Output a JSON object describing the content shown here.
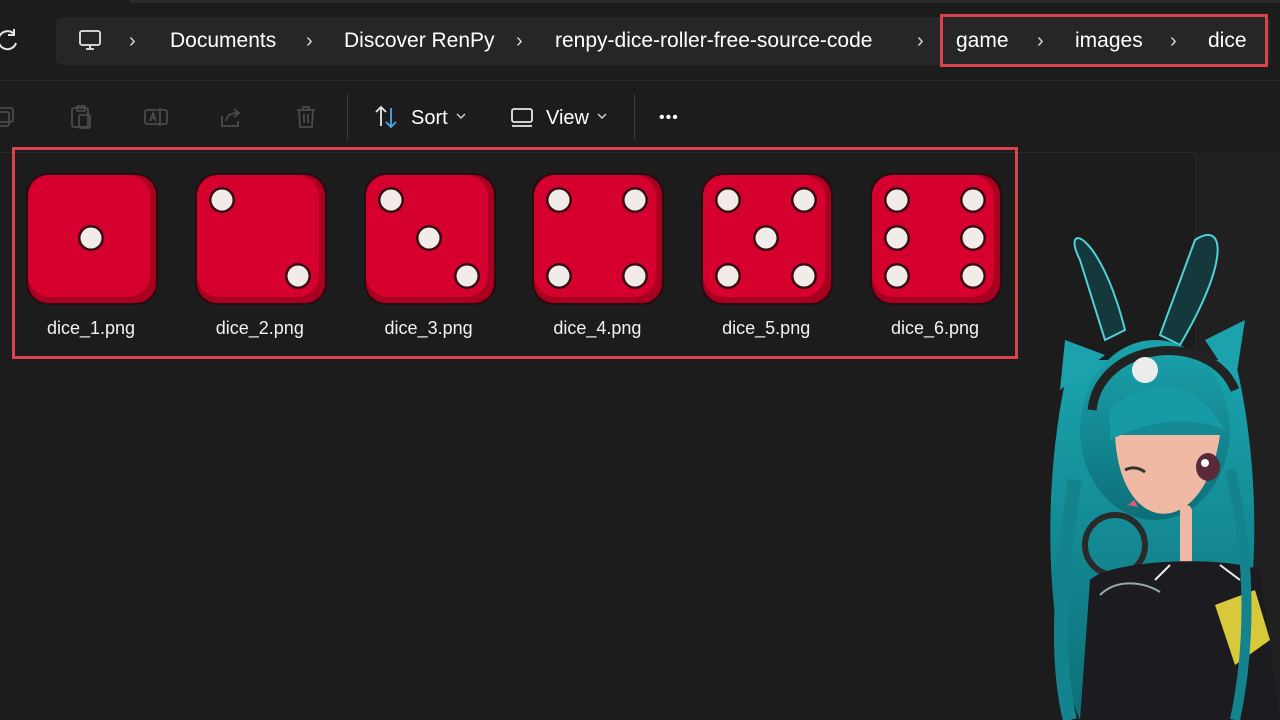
{
  "address_bar": {
    "crumbs": [
      "Documents",
      "Discover RenPy",
      "renpy-dice-roller-free-source-code",
      "game",
      "images",
      "dice"
    ],
    "separator": "›"
  },
  "toolbar": {
    "sort_label": "Sort",
    "view_label": "View",
    "more_label": "•••"
  },
  "files": [
    {
      "name": "dice_1.png",
      "pips": 1
    },
    {
      "name": "dice_2.png",
      "pips": 2
    },
    {
      "name": "dice_3.png",
      "pips": 3
    },
    {
      "name": "dice_4.png",
      "pips": 4
    },
    {
      "name": "dice_5.png",
      "pips": 5
    },
    {
      "name": "dice_6.png",
      "pips": 6
    }
  ],
  "colors": {
    "highlight": "#d8434d",
    "die_face": "#d6002f",
    "die_edge": "#a8001f",
    "pip": "#f2ece8",
    "avatar_hair": "#1b8f99"
  },
  "icons": {
    "refresh": "refresh-icon",
    "computer": "computer-icon",
    "copy": "copy-icon",
    "paste": "paste-icon",
    "rename": "rename-icon",
    "share": "share-icon",
    "delete": "delete-icon",
    "sort": "sort-icon",
    "view": "view-icon",
    "more": "more-icon"
  }
}
